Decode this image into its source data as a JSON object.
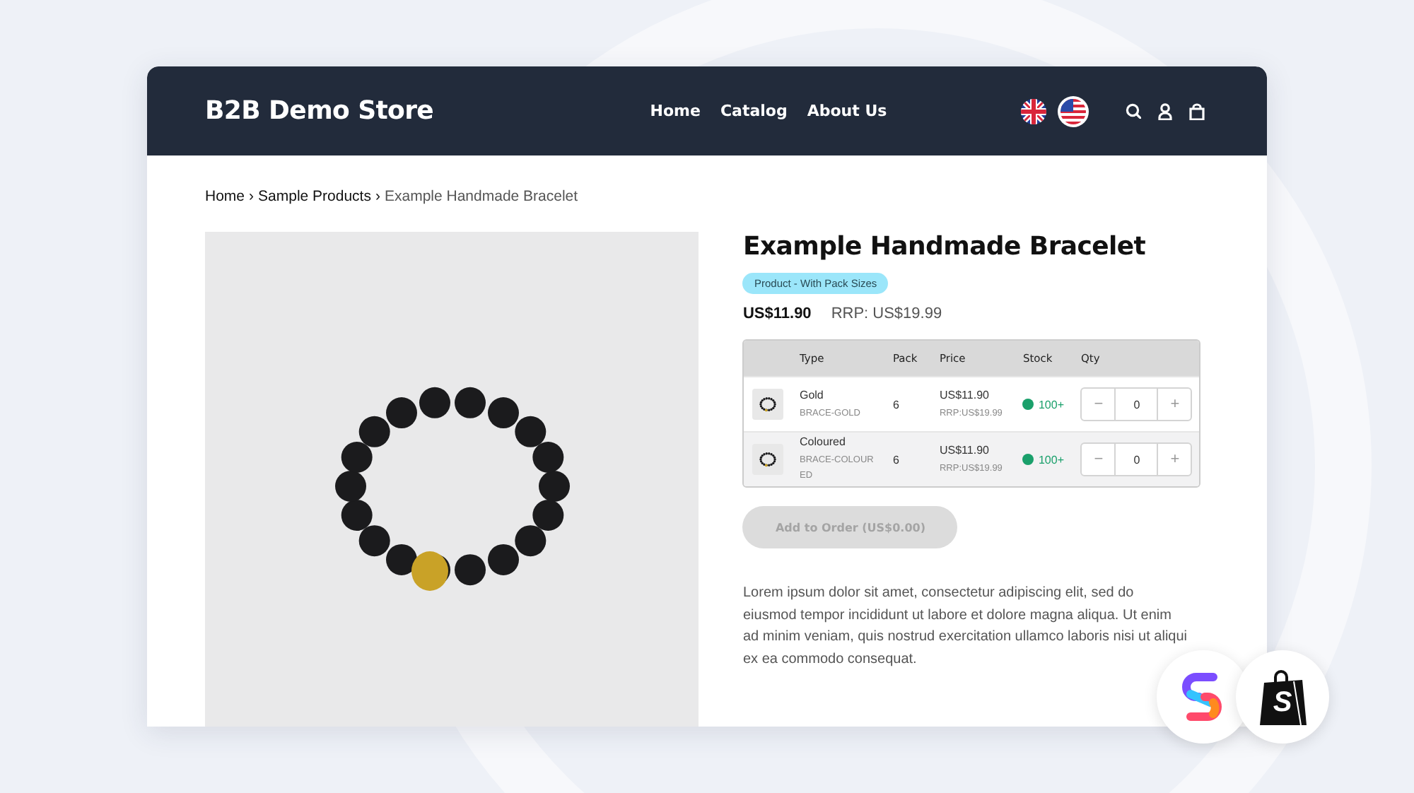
{
  "store": {
    "name": "B2B Demo Store"
  },
  "nav": [
    {
      "label": "Home"
    },
    {
      "label": "Catalog"
    },
    {
      "label": "About Us"
    }
  ],
  "breadcrumb": [
    {
      "kind": "link",
      "label": "Home"
    },
    {
      "kind": "separator",
      "label": "›"
    },
    {
      "kind": "link",
      "label": "Sample Products"
    },
    {
      "kind": "separator",
      "label": "›"
    },
    {
      "kind": "current",
      "label": "Example Handmade Bracelet"
    }
  ],
  "product": {
    "title": "Example Handmade Bracelet",
    "tag": "Product - With Pack Sizes",
    "price": "US$11.90",
    "rrp": "RRP: US$19.99",
    "table": {
      "columns": [
        "Type",
        "Pack",
        "Price",
        "Stock",
        "Qty"
      ],
      "rows": [
        {
          "type": "Gold",
          "sku": "BRACE-GOLD",
          "pack": "6",
          "price": "US$11.90",
          "rrp": "RRP:US$19.99",
          "in_stock": true,
          "stock": "100+",
          "minus": "−",
          "qty": "0",
          "plus": "+"
        },
        {
          "type": "Coloured",
          "sku": "BRACE-COLOURED",
          "pack": "6",
          "price": "US$11.90",
          "rrp": "RRP:US$19.99",
          "in_stock": true,
          "stock": "100+",
          "minus": "−",
          "qty": "0",
          "plus": "+"
        }
      ]
    },
    "add_button": {
      "label": "Add to Order (US$0.00)",
      "disabled": true
    },
    "description": "Lorem ipsum dolor sit amet, consectetur adipiscing elit, sed do eiusmod tempor incididunt ut labore et dolore magna aliqua. Ut enim ad minim veniam, quis nostrud exercitation ullamco laboris nisi ut aliqui"
  },
  "description_end": "ex ea commodo consequat.",
  "badges": [
    {
      "kind": "link-logo"
    },
    {
      "kind": "bag-logo",
      "letter": "S"
    }
  ]
}
